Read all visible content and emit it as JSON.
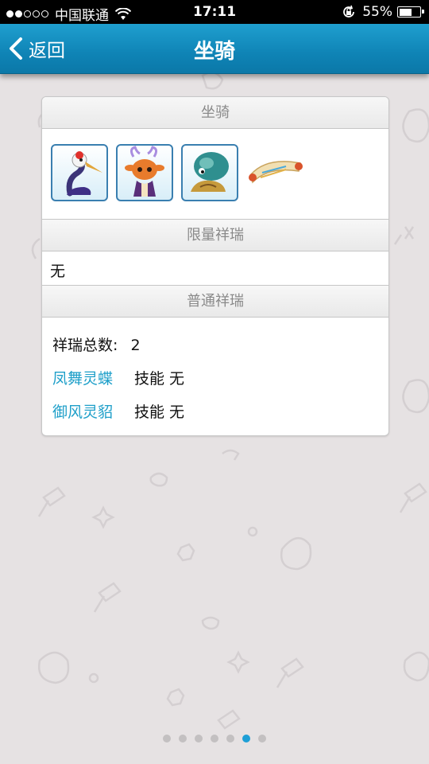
{
  "status_bar": {
    "carrier": "中国联通",
    "time": "17:11",
    "battery": "55%",
    "signal_bars_filled": 2,
    "signal_bars_total": 5,
    "battery_level": 0.55
  },
  "nav": {
    "back_label": "返回",
    "title": "坐骑"
  },
  "sections": {
    "mounts_header": "坐骑",
    "mounts": [
      {
        "name": "crane-mount-icon"
      },
      {
        "name": "deer-mount-icon"
      },
      {
        "name": "turtle-mount-icon"
      },
      {
        "name": "scroll-mount-icon"
      }
    ],
    "limited_header": "限量祥瑞",
    "limited_value": "无",
    "normal_header": "普通祥瑞",
    "normal_total_label": "祥瑞总数:",
    "normal_total_value": "2",
    "normal_items": [
      {
        "name": "凤舞灵蝶",
        "skill": "技能 无"
      },
      {
        "name": "御风灵貂",
        "skill": "技能 无"
      }
    ]
  },
  "pagination": {
    "total": 7,
    "active_index": 5
  },
  "colors": {
    "nav_bar": "#1590c3",
    "link_text": "#1e9fc9",
    "active_dot": "#1e9fd6",
    "background": "#e6e2e3"
  }
}
